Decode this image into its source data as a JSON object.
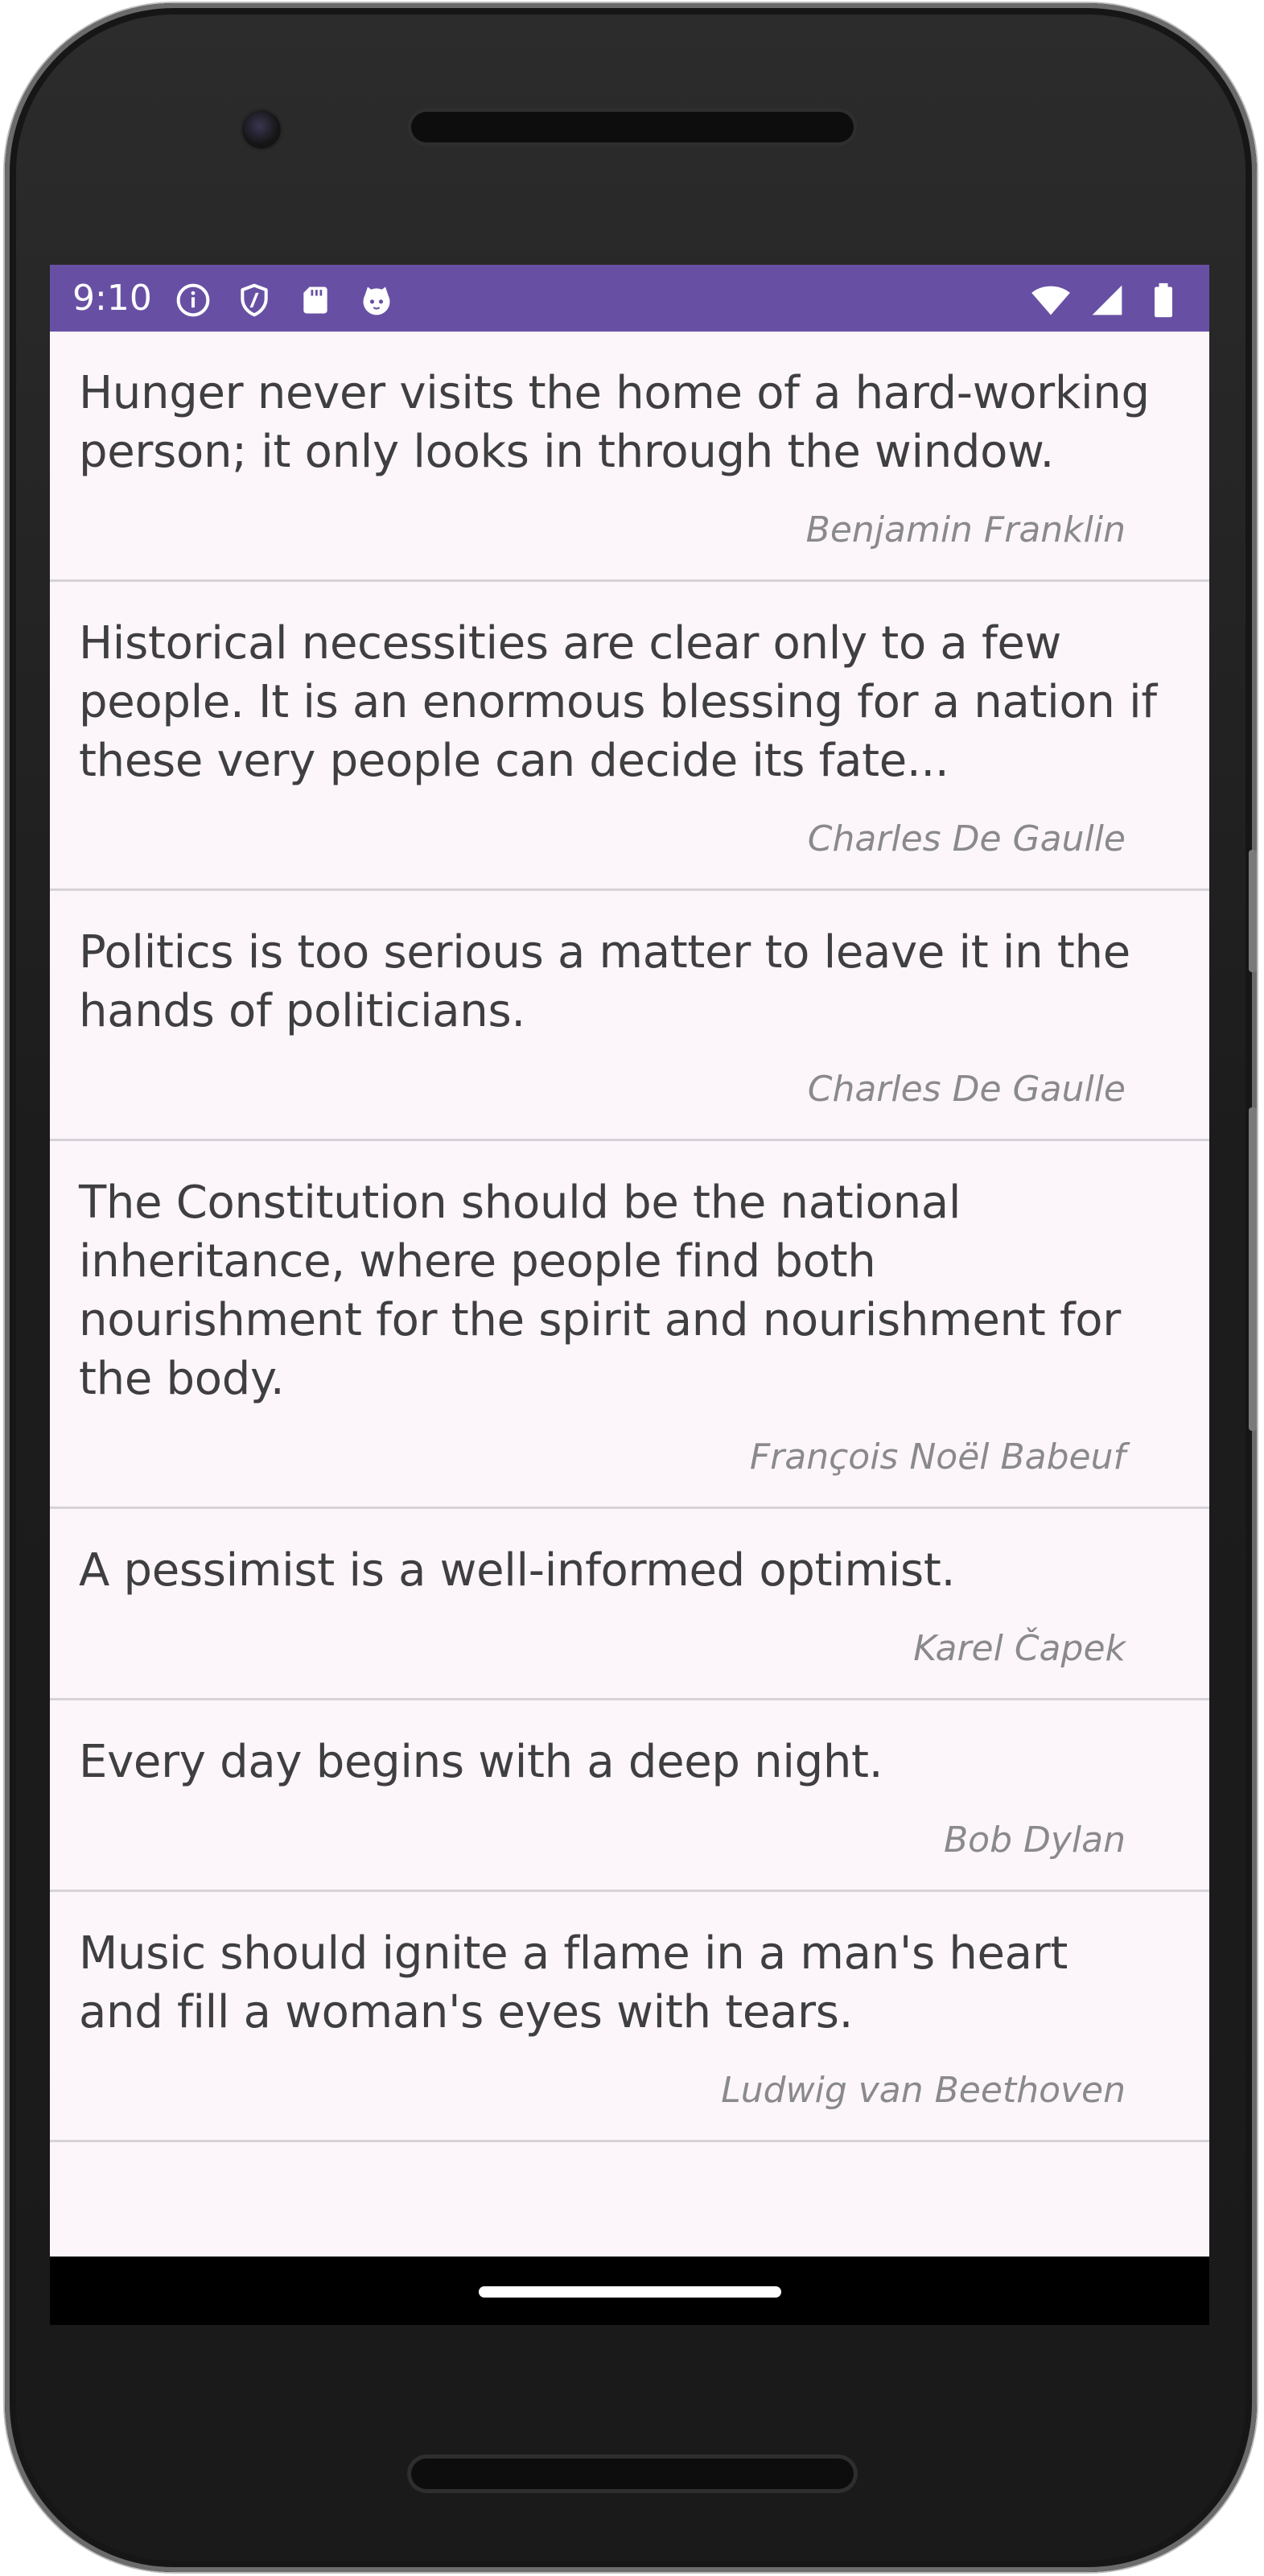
{
  "status_bar": {
    "time": "9:10",
    "background_color": "#6750a4",
    "left_icons": [
      "info-icon",
      "shield-icon",
      "sd-card-icon",
      "cat-icon"
    ],
    "right_icons": [
      "wifi-icon",
      "signal-icon",
      "battery-icon"
    ]
  },
  "quotes": [
    {
      "text": "Hunger never visits the home of a hard-working person; it only looks in through the window.",
      "author": "Benjamin Franklin"
    },
    {
      "text": "Historical necessities are clear only to a few people. It is an enormous blessing for a nation if these very people can decide its fate...",
      "author": "Charles De Gaulle"
    },
    {
      "text": "Politics is too serious a matter to leave it in the hands of politicians.",
      "author": "Charles De Gaulle"
    },
    {
      "text": "The Constitution should be the national inheritance, where people find both nourishment for the spirit and nourishment for the body.",
      "author": "François Noël Babeuf"
    },
    {
      "text": "A pessimist is a well-informed optimist.",
      "author": "Karel Čapek"
    },
    {
      "text": "Every day begins with a deep night.",
      "author": "Bob Dylan"
    },
    {
      "text": "Music should ignite a flame in a man's heart and fill a woman's eyes with tears.",
      "author": "Ludwig van Beethoven"
    }
  ],
  "colors": {
    "list_background": "#fcf6fb",
    "quote_text": "#3f3f3f",
    "author_text": "#8a8a8a",
    "divider": "#d7d2d7"
  }
}
